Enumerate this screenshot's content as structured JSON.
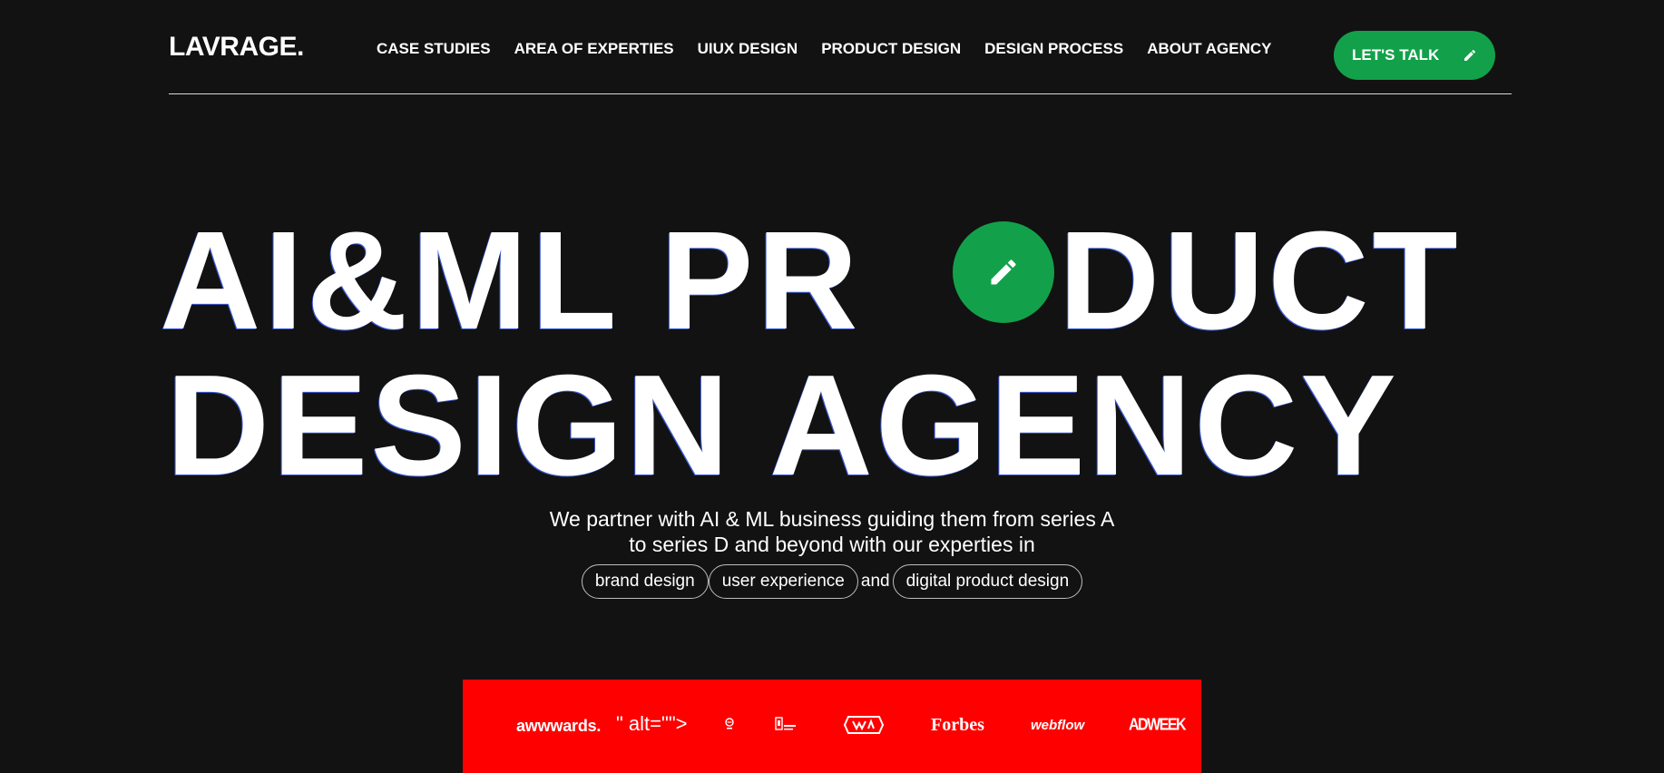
{
  "header": {
    "logo": "LAVRAGE.",
    "nav": [
      "CASE STUDIES",
      "AREA OF EXPERTIES",
      "UIUX DESIGN",
      "PRODUCT DESIGN",
      "DESIGN PROCESS",
      "ABOUT AGENCY"
    ],
    "cta_label": "LET'S TALK",
    "cta_icon": "pencil-icon"
  },
  "hero": {
    "line1_part1": "AI&ML PR",
    "line1_part2": "DUCT",
    "line2": "DESIGN AGENCY",
    "badge_icon": "pencil-icon",
    "accent_color": "#12a14a"
  },
  "intro": {
    "line1": "We partner with AI & ML business guiding them from series A",
    "line2": "to series D and beyond with our experties in",
    "chips": [
      "brand design",
      "user experience",
      "digital product design"
    ],
    "connector": "and"
  },
  "awards": {
    "background_color": "#ff0000",
    "logos": {
      "awwwards": "awwwards.",
      "broken_alt": "\" alt=\"\">",
      "forbes": "Forbes",
      "webflow": "webflow",
      "adweek": "ADWEEK"
    }
  }
}
